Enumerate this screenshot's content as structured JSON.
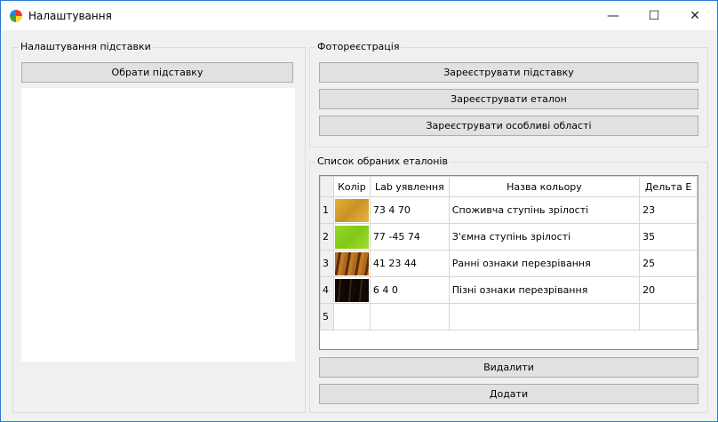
{
  "window": {
    "title": "Налаштування",
    "minimize": "—",
    "maximize": "☐",
    "close": "✕",
    "icon": "color-wheel-icon"
  },
  "stand_group": {
    "legend": "Налаштування підставки",
    "choose_button": "Обрати підставку"
  },
  "photo_group": {
    "legend": "Фотореєстрація",
    "buttons": [
      "Зареєструвати підставку",
      "Зареєструвати еталон",
      "Зареєструвати особливі області"
    ]
  },
  "list_group": {
    "legend": "Список обраних еталонів",
    "columns": [
      "Колір",
      "Lab уявлення",
      "Назва кольору",
      "Дельта E"
    ],
    "rows": [
      {
        "num": "1",
        "color": "#d8a531",
        "lab": "73 4 70",
        "name": "Споживча ступінь зрілості",
        "delta": "23"
      },
      {
        "num": "2",
        "color": "#8ed21c",
        "lab": "77 -45 74",
        "name": "З'ємна ступінь зрілості",
        "delta": "35"
      },
      {
        "num": "3",
        "color": "#8a5214",
        "lab": "41 23 44",
        "name": "Ранні ознаки перезрівання",
        "delta": "25"
      },
      {
        "num": "4",
        "color": "#1a0e06",
        "lab": "6 4 0",
        "name": "Пізні ознаки перезрівання",
        "delta": "20"
      },
      {
        "num": "5",
        "color": "",
        "lab": "",
        "name": "",
        "delta": ""
      }
    ],
    "delete_button": "Видалити",
    "add_button": "Додати"
  }
}
